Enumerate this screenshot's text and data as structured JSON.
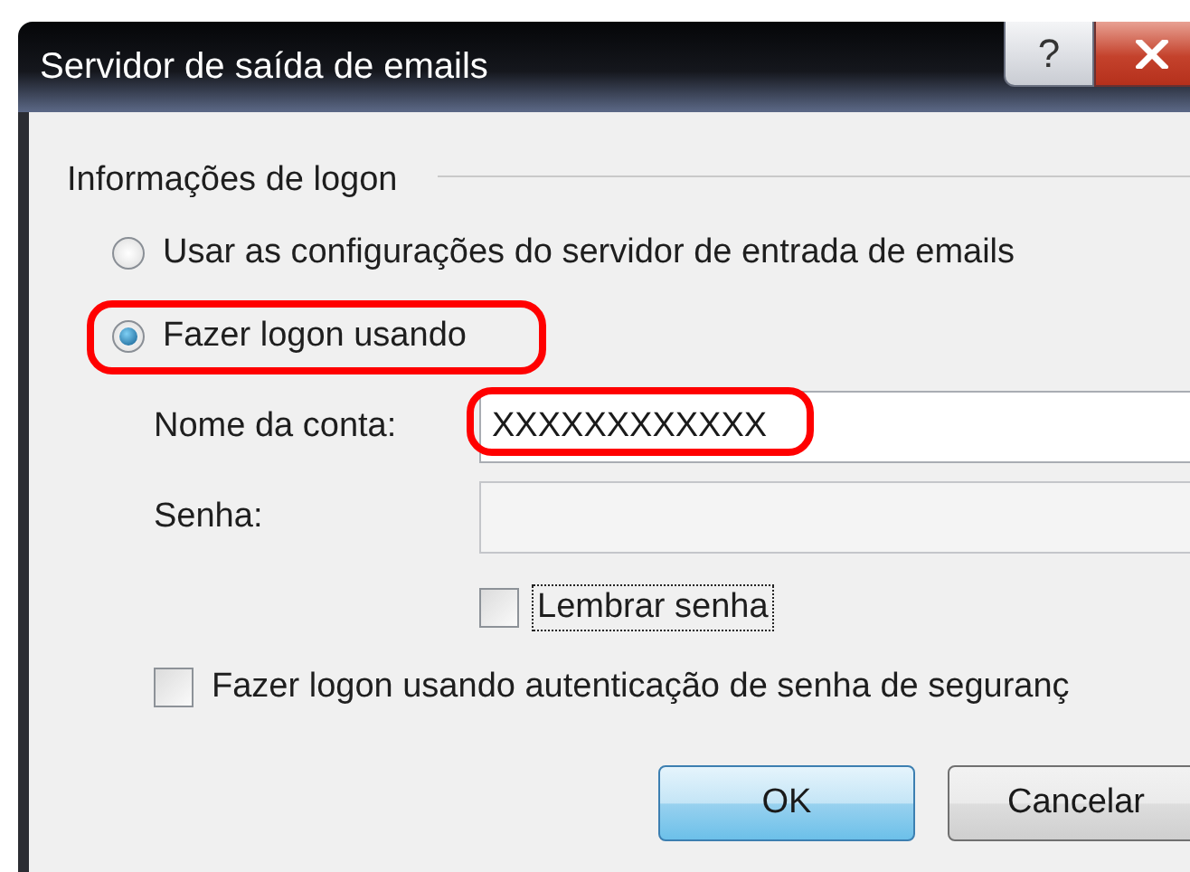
{
  "window": {
    "title": "Servidor de saída de emails",
    "help_button": "?"
  },
  "group": {
    "label": "Informações de logon"
  },
  "logon_options": [
    {
      "label": "Usar as configurações do servidor de entrada de emails",
      "selected": false,
      "highlighted": false
    },
    {
      "label": "Fazer logon usando",
      "selected": true,
      "highlighted": true
    }
  ],
  "fields": [
    {
      "label": "Nome da conta:",
      "value": "XXXXXXXXXXXX",
      "highlighted": true
    },
    {
      "label": "Senha:",
      "highlighted": false
    }
  ],
  "remember_password": {
    "label": "Lembrar senha",
    "checked": false,
    "focused": true
  },
  "secure_auth": {
    "label": "Fazer logon usando autenticação de senha de seguranç",
    "checked": false
  },
  "buttons": [
    {
      "label": "OK",
      "default": true
    },
    {
      "label": "Cancelar",
      "default": false
    }
  ]
}
